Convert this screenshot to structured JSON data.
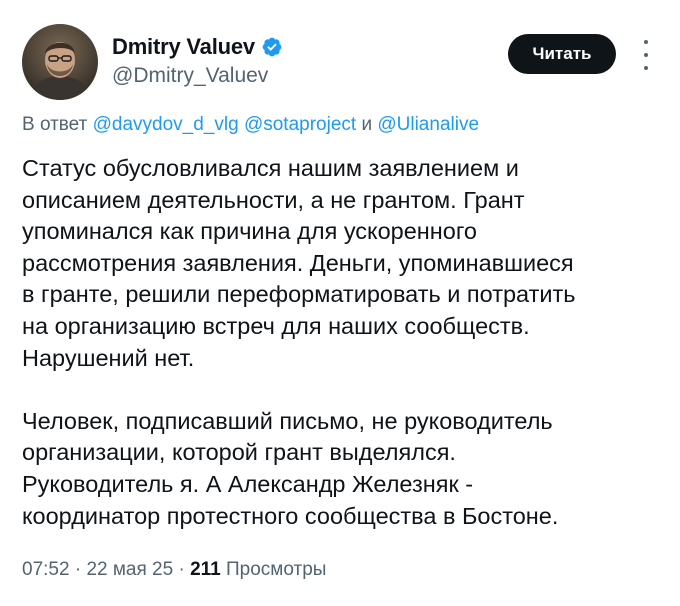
{
  "author": {
    "name": "Dmitry Valuev",
    "handle": "@Dmitry_Valuev",
    "verified_color": "#1d9bf0"
  },
  "follow_button": {
    "label": "Читать"
  },
  "more_icon": "more-vertical-icon",
  "reply": {
    "prefix": "В ответ",
    "mention_1": "@davydov_d_vlg",
    "mention_2": "@sotaproject",
    "conjunction": "и",
    "mention_3": "@Ulianalive"
  },
  "text": {
    "p1": [
      "Статус обусловливался нашим заявлением и",
      "описанием деятельности, а не грантом. Грант",
      "упоминался как причина для ускоренного",
      "рассмотрения заявления. Деньги, упоминавшиеся",
      "в гранте, решили переформатировать и потратить",
      "на организацию встреч для наших сообществ.",
      "Нарушений нет."
    ],
    "p2": [
      "Человек, подписавший письмо, не руководитель",
      "организации, которой грант выделялся.",
      "Руководитель я. А Александр Железняк -",
      "координатор протестного сообщества в Бостоне."
    ]
  },
  "meta": {
    "time": "07:52",
    "separator": "·",
    "date": "22 мая 25",
    "views_count": "211",
    "views_label": "Просмотры"
  },
  "colors": {
    "text": "#0f1419",
    "secondary": "#536471",
    "link": "#1d9bf0",
    "button_bg": "#0f1419"
  }
}
